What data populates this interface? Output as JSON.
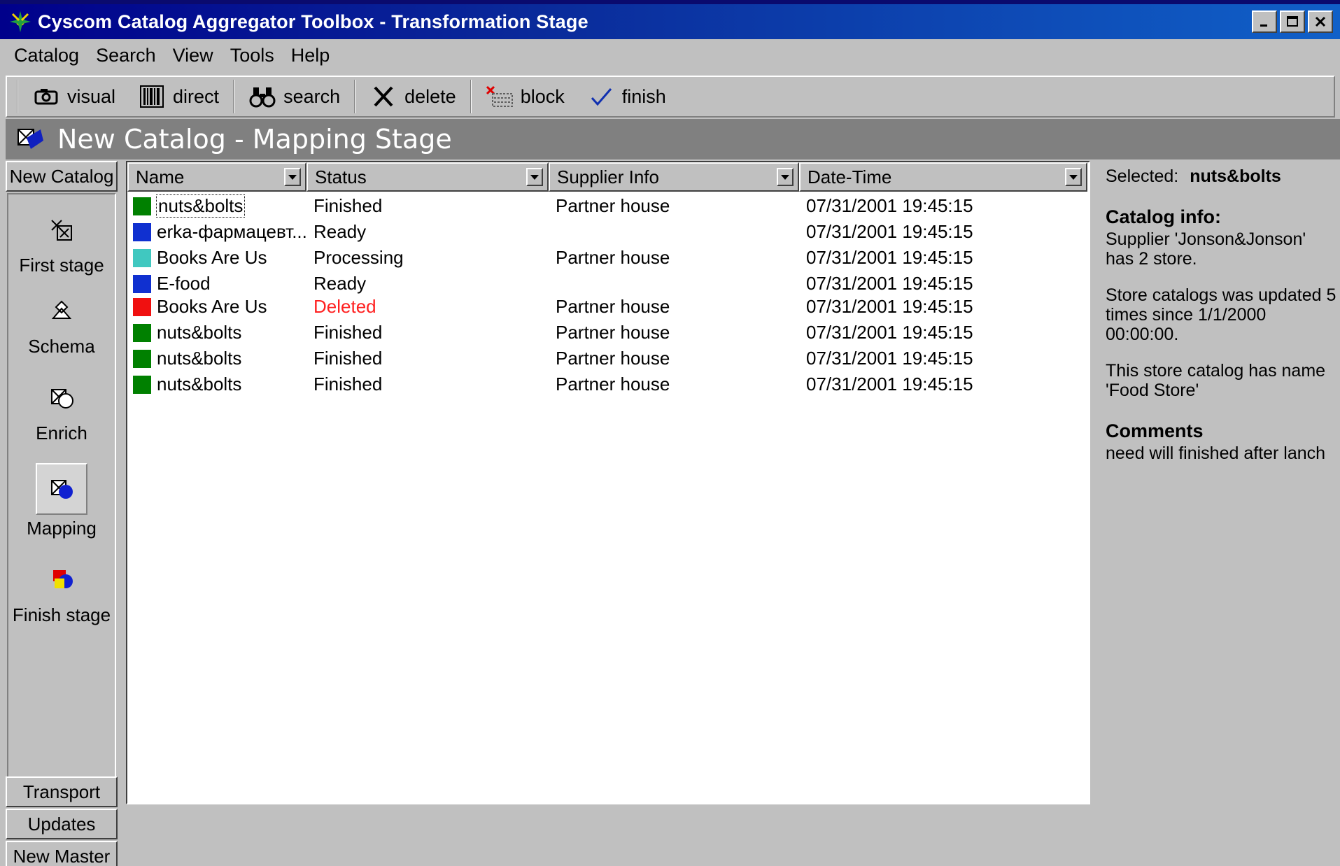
{
  "window": {
    "title": "Cyscom Catalog Aggregator Toolbox - Transformation Stage",
    "minimize": "_",
    "maximize": "□",
    "close": "✕"
  },
  "menu": [
    {
      "label": "Catalog"
    },
    {
      "label": "Search"
    },
    {
      "label": "View"
    },
    {
      "label": "Tools"
    },
    {
      "label": "Help"
    }
  ],
  "toolbar": {
    "visual": "visual",
    "direct": "direct",
    "search": "search",
    "delete": "delete",
    "block": "block",
    "finish": "finish"
  },
  "stage": {
    "title": "New Catalog - Mapping Stage"
  },
  "leftbar": {
    "top_group": "New Catalog",
    "items": [
      {
        "label": "First stage"
      },
      {
        "label": "Schema"
      },
      {
        "label": "Enrich"
      },
      {
        "label": "Mapping"
      },
      {
        "label": "Finish stage"
      }
    ],
    "bottom_groups": [
      "Transport",
      "Updates",
      "New Master"
    ]
  },
  "table": {
    "columns": [
      "Name",
      "Status",
      "Supplier Info",
      "Date-Time"
    ],
    "rows": [
      {
        "color": "#008000",
        "name": "nuts&bolts",
        "status": "Finished",
        "supplier": "Partner house",
        "datetime": "07/31/2001 19:45:15"
      },
      {
        "color": "#1030d0",
        "name": "erka-фармацевт...",
        "status": "Ready",
        "supplier": "",
        "datetime": "07/31/2001 19:45:15"
      },
      {
        "color": "#40c8c0",
        "name": "Books Are Us",
        "status": "Processing",
        "supplier": "Partner house",
        "datetime": "07/31/2001 19:45:15"
      },
      {
        "color": "#1030d0",
        "name": "E-food",
        "status": "Ready",
        "supplier": "",
        "datetime": "07/31/2001 19:45:15"
      },
      {
        "color": "#f01010",
        "name": "Books Are Us",
        "status": "Deleted",
        "supplier": "Partner house",
        "datetime": "07/31/2001 19:45:15"
      },
      {
        "color": "#008000",
        "name": "nuts&bolts",
        "status": "Finished",
        "supplier": "Partner house",
        "datetime": "07/31/2001 19:45:15"
      },
      {
        "color": "#008000",
        "name": "nuts&bolts",
        "status": "Finished",
        "supplier": "Partner house",
        "datetime": "07/31/2001 19:45:15"
      },
      {
        "color": "#008000",
        "name": "nuts&bolts",
        "status": "Finished",
        "supplier": "Partner house",
        "datetime": "07/31/2001 19:45:15"
      }
    ],
    "deleted_color": "#ff2020"
  },
  "info": {
    "selected_label": "Selected:",
    "selected_value": "nuts&bolts",
    "catalog_info_heading": "Catalog info:",
    "para1": "Supplier 'Jonson&Jonson' has 2 store.",
    "para2": "Store catalogs was updated 5 times since 1/1/2000 00:00:00.",
    "para3": "This store catalog has name 'Food Store'",
    "comments_heading": "Comments",
    "comments": "need will finished after lanch"
  }
}
